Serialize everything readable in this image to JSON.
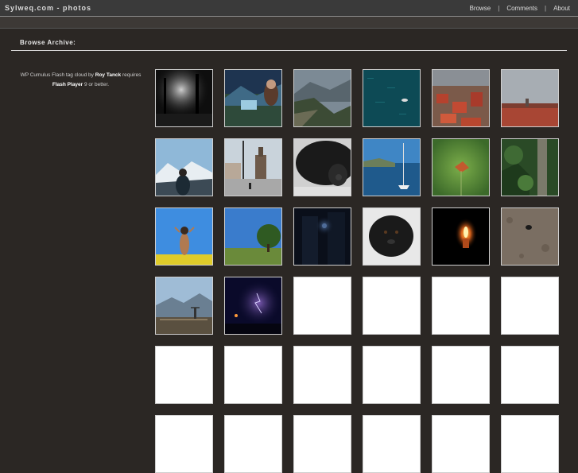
{
  "header": {
    "logo": "Sylweq.com - photos",
    "nav": [
      {
        "label": "Browse"
      },
      {
        "label": "Comments"
      },
      {
        "label": "About"
      }
    ],
    "separator": "|"
  },
  "section": {
    "title": "Browse Archive:"
  },
  "sidebar": {
    "prefix": "WP Cumulus Flash tag cloud by",
    "author": "Roy Tanck",
    "requires": "requires",
    "plugin": "Flash Player",
    "suffix": "9 or better."
  },
  "thumbnails": [
    {
      "scene": "dark-forest-light"
    },
    {
      "scene": "woman-mountain-dusk"
    },
    {
      "scene": "mountain-valley-clouds"
    },
    {
      "scene": "teal-water-boat"
    },
    {
      "scene": "red-roof-city"
    },
    {
      "scene": "city-panorama-sky"
    },
    {
      "scene": "woman-snowy-mountains"
    },
    {
      "scene": "old-town-square"
    },
    {
      "scene": "black-cat-closeup"
    },
    {
      "scene": "harbor-sailboat"
    },
    {
      "scene": "butterfly-green"
    },
    {
      "scene": "forest-trees"
    },
    {
      "scene": "woman-blue-sky-field"
    },
    {
      "scene": "tree-meadow-sky"
    },
    {
      "scene": "night-alley-lamp"
    },
    {
      "scene": "black-dog-portrait"
    },
    {
      "scene": "candle-flame"
    },
    {
      "scene": "beetle-ground"
    },
    {
      "scene": "hiker-mountain-view"
    },
    {
      "scene": "night-lightning"
    },
    {
      "scene": "blank"
    },
    {
      "scene": "blank"
    },
    {
      "scene": "blank"
    },
    {
      "scene": "blank"
    },
    {
      "scene": "blank"
    },
    {
      "scene": "blank"
    },
    {
      "scene": "blank"
    },
    {
      "scene": "blank"
    },
    {
      "scene": "blank"
    },
    {
      "scene": "blank"
    },
    {
      "scene": "blank"
    },
    {
      "scene": "blank"
    },
    {
      "scene": "blank"
    },
    {
      "scene": "blank"
    },
    {
      "scene": "blank"
    },
    {
      "scene": "blank"
    }
  ]
}
